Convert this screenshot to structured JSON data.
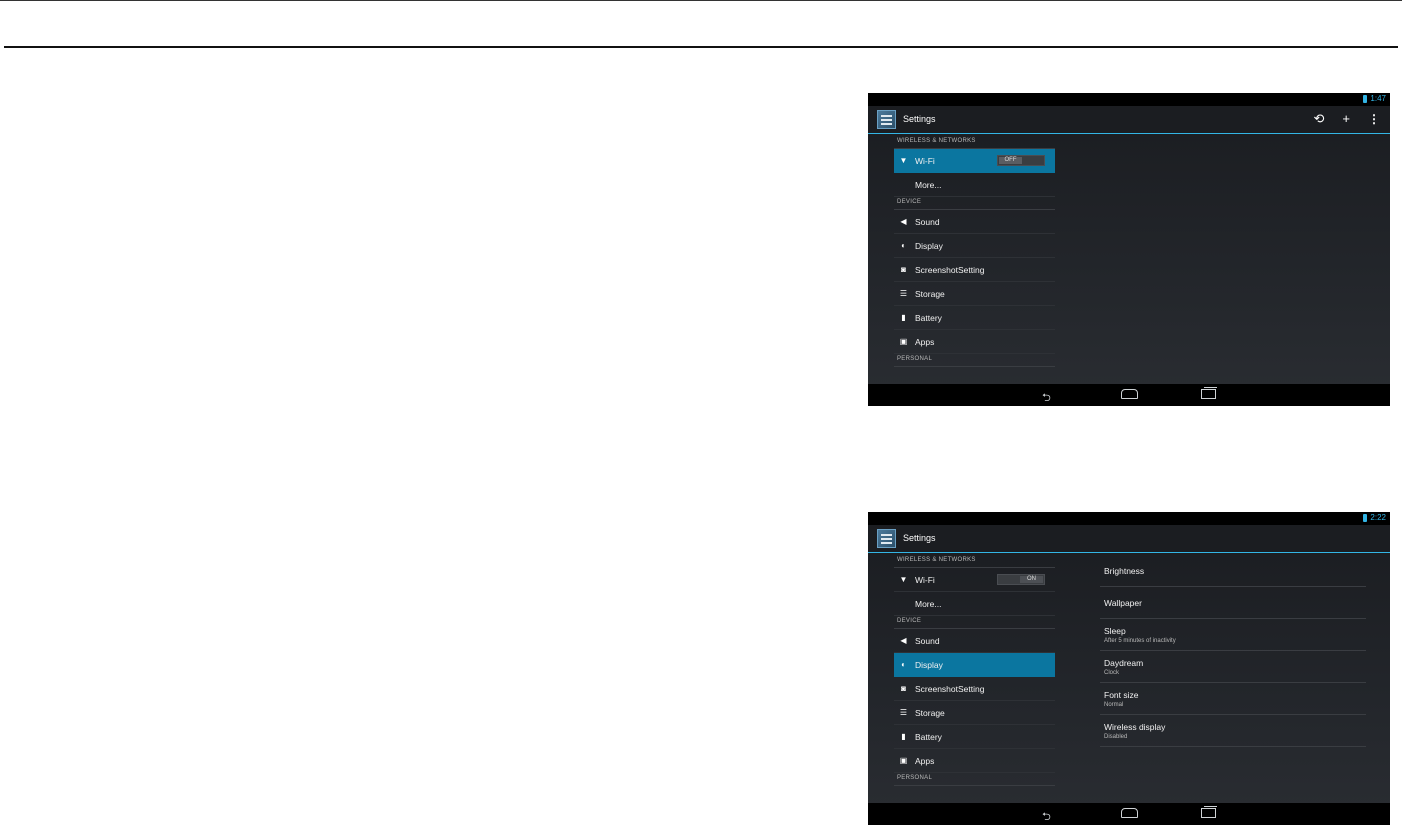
{
  "screen1": {
    "status_time": "1:47",
    "app_title": "Settings",
    "action_icons": [
      "sync-icon",
      "add-icon",
      "overflow-menu-icon"
    ],
    "list": {
      "wireless_header": "WIRELESS & NETWORKS",
      "wifi_label": "Wi-Fi",
      "wifi_toggle": "OFF",
      "more_label": "More...",
      "device_header": "DEVICE",
      "sound_label": "Sound",
      "display_label": "Display",
      "screenshot_label": "ScreenshotSetting",
      "storage_label": "Storage",
      "battery_label": "Battery",
      "apps_label": "Apps",
      "personal_header": "PERSONAL"
    },
    "selected": "Wi-Fi"
  },
  "screen2": {
    "status_time": "2:22",
    "app_title": "Settings",
    "list": {
      "wireless_header": "WIRELESS & NETWORKS",
      "wifi_label": "Wi-Fi",
      "wifi_toggle": "ON",
      "more_label": "More...",
      "device_header": "DEVICE",
      "sound_label": "Sound",
      "display_label": "Display",
      "screenshot_label": "ScreenshotSetting",
      "storage_label": "Storage",
      "battery_label": "Battery",
      "apps_label": "Apps",
      "personal_header": "PERSONAL"
    },
    "selected": "Display",
    "display_settings": [
      {
        "title": "Brightness",
        "subtitle": ""
      },
      {
        "title": "Wallpaper",
        "subtitle": ""
      },
      {
        "title": "Sleep",
        "subtitle": "After 5 minutes of inactivity"
      },
      {
        "title": "Daydream",
        "subtitle": "Clock"
      },
      {
        "title": "Font size",
        "subtitle": "Normal"
      },
      {
        "title": "Wireless display",
        "subtitle": "Disabled"
      }
    ]
  },
  "colors": {
    "accent": "#33b5e5",
    "selected_row": "#0b76a0",
    "background": "#1f2226"
  }
}
